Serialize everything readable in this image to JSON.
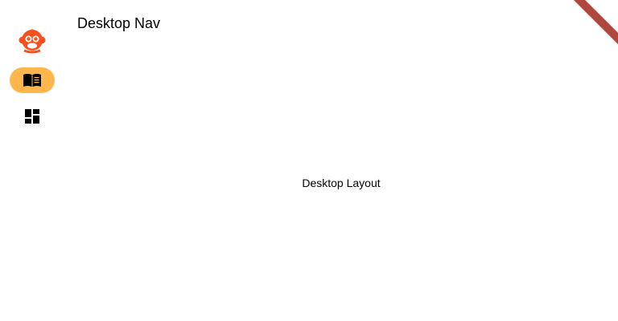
{
  "app_bar": {
    "title": "Desktop Nav"
  },
  "navigation_rail": {
    "logo_icon": "monkey-logo-icon",
    "items": [
      {
        "icon": "book-icon",
        "selected": true
      },
      {
        "icon": "dashboard-icon",
        "selected": false
      }
    ]
  },
  "main": {
    "body_text": "Desktop Layout"
  },
  "debug_banner": {
    "color": "#b0473f"
  },
  "colors": {
    "rail_selected_indicator": "#ffb74d",
    "logo": "#f4511e",
    "icon": "#000000"
  }
}
